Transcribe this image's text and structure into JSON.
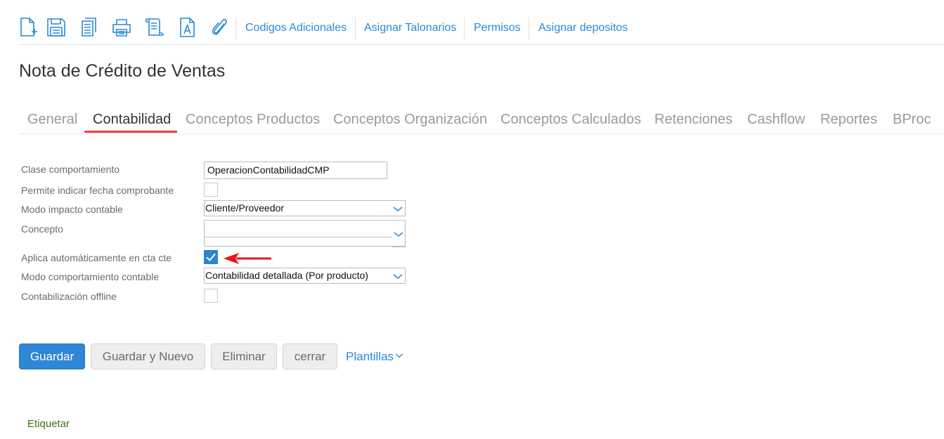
{
  "toolbar": {
    "icons": [
      "new-document-icon",
      "save-icon",
      "copy-icon",
      "print-icon",
      "script-icon",
      "font-document-icon",
      "attach-icon"
    ],
    "links": [
      "Codigos Adicionales",
      "Asignar Talonarios",
      "Permisos",
      "Asignar depositos"
    ]
  },
  "page": {
    "title": "Nota de Crédito de Ventas"
  },
  "tabs": {
    "items": [
      "General",
      "Contabilidad",
      "Conceptos Productos",
      "Conceptos Organización",
      "Conceptos Calculados",
      "Retenciones",
      "Cashflow",
      "Reportes",
      "BProc"
    ],
    "active": "Contabilidad",
    "active_color": "#e2443a"
  },
  "form": {
    "clase": {
      "label": "Clase comportamiento",
      "value": "OperacionContabilidadCMP"
    },
    "fecha": {
      "label": "Permite indicar fecha comprobante",
      "checked": false
    },
    "modo_impacto": {
      "label": "Modo impacto contable",
      "value": "Cliente/Proveedor"
    },
    "concepto": {
      "label": "Concepto",
      "value": ""
    },
    "aplica": {
      "label": "Aplica automáticamente en cta cte",
      "checked": true
    },
    "modo_comportamiento": {
      "label": "Modo comportamiento contable",
      "value": "Contabilidad detallada (Por producto)"
    },
    "offline": {
      "label": "Contabilización offline",
      "checked": false
    }
  },
  "annotation": {
    "arrow_color": "#e8151b"
  },
  "actions": {
    "save": "Guardar",
    "save_new": "Guardar y Nuevo",
    "delete": "Eliminar",
    "close": "cerrar",
    "templates": "Plantillas"
  },
  "footer": {
    "tag_link": "Etiquetar"
  },
  "colors": {
    "accent": "#2a8ad6",
    "primary_button": "#2f86d6",
    "checkbox_checked": "#2d84cf",
    "tag_link": "#3c6f19"
  }
}
